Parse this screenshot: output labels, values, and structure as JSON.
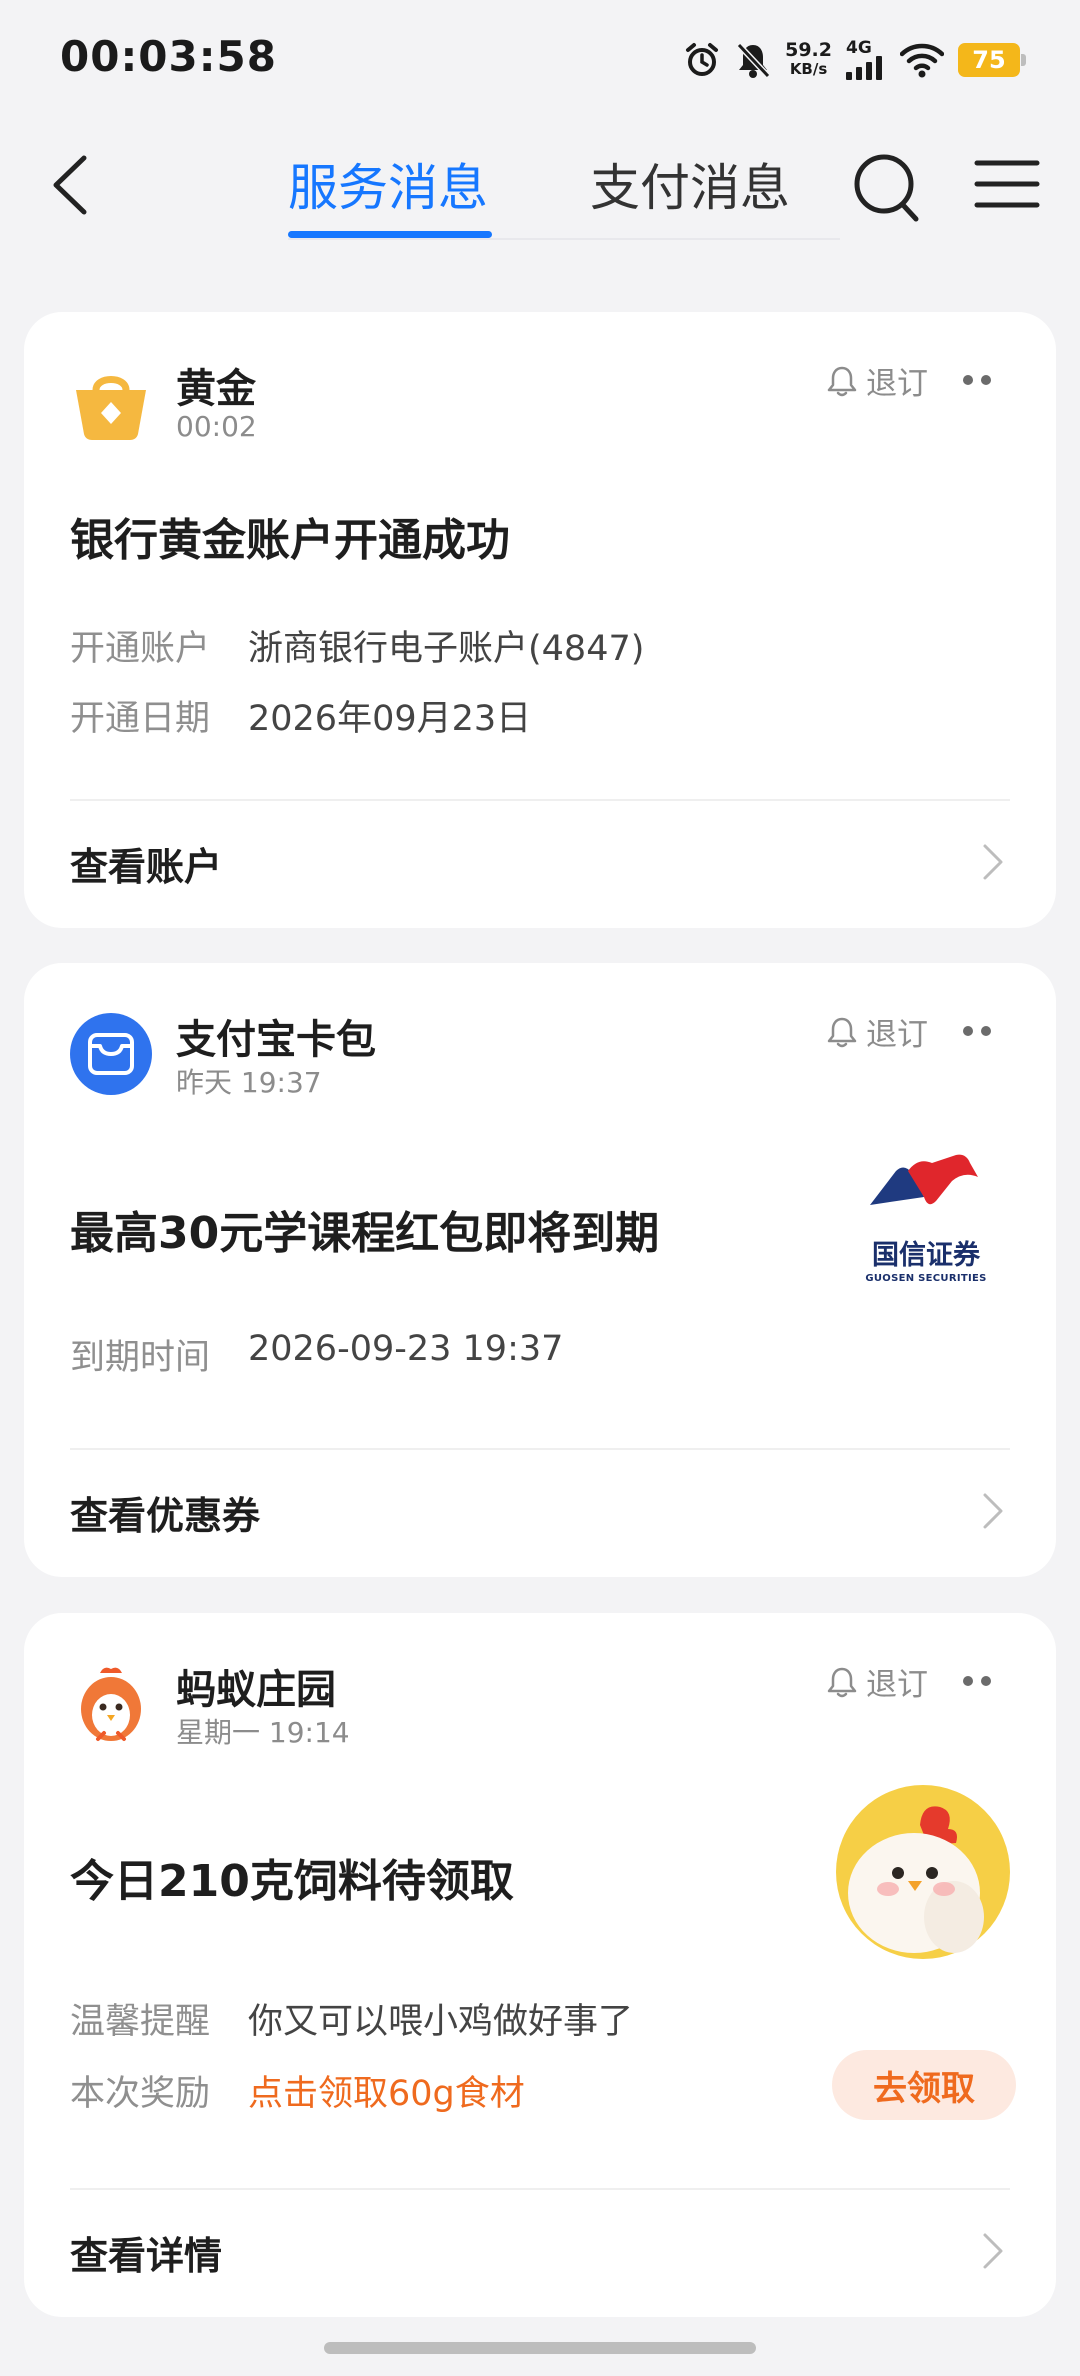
{
  "status_bar": {
    "time": "00:03:58",
    "speed_value": "59.2",
    "speed_unit": "KB/s",
    "network": "4G",
    "battery": "75"
  },
  "nav": {
    "tabs": [
      {
        "label": "服务消息",
        "active": true
      },
      {
        "label": "支付消息",
        "active": false
      }
    ]
  },
  "colors": {
    "accent": "#1677ff",
    "orange": "#ef6a1e",
    "gold": "#f5b840",
    "alipay_blue": "#2f73ee"
  },
  "cards": [
    {
      "name": "黄金",
      "time": "00:02",
      "logo_icon": "gold-basket-icon",
      "subscribe_label": "退订",
      "title": "银行黄金账户开通成功",
      "rows": [
        {
          "label": "开通账户",
          "value": "浙商银行电子账户(4847)"
        },
        {
          "label": "开通日期",
          "value": "2026年09月23日"
        }
      ],
      "action_label": "查看账户"
    },
    {
      "name": "支付宝卡包",
      "time": "昨天 19:37",
      "logo_icon": "card-wallet-icon",
      "subscribe_label": "退订",
      "title": "最高30元学课程红包即将到期",
      "image_text": "国信证券",
      "image_subtext": "GUOSEN SECURITIES",
      "rows": [
        {
          "label": "到期时间",
          "value": "2026-09-23 19:37"
        }
      ],
      "action_label": "查看优惠券"
    },
    {
      "name": "蚂蚁庄园",
      "time": "星期一 19:14",
      "logo_icon": "chick-icon",
      "subscribe_label": "退订",
      "title": "今日210克饲料待领取",
      "rows": [
        {
          "label": "温馨提醒",
          "value": "你又可以喂小鸡做好事了"
        },
        {
          "label": "本次奖励",
          "value": "点击领取60g食材"
        }
      ],
      "button_label": "去领取",
      "action_label": "查看详情"
    }
  ]
}
